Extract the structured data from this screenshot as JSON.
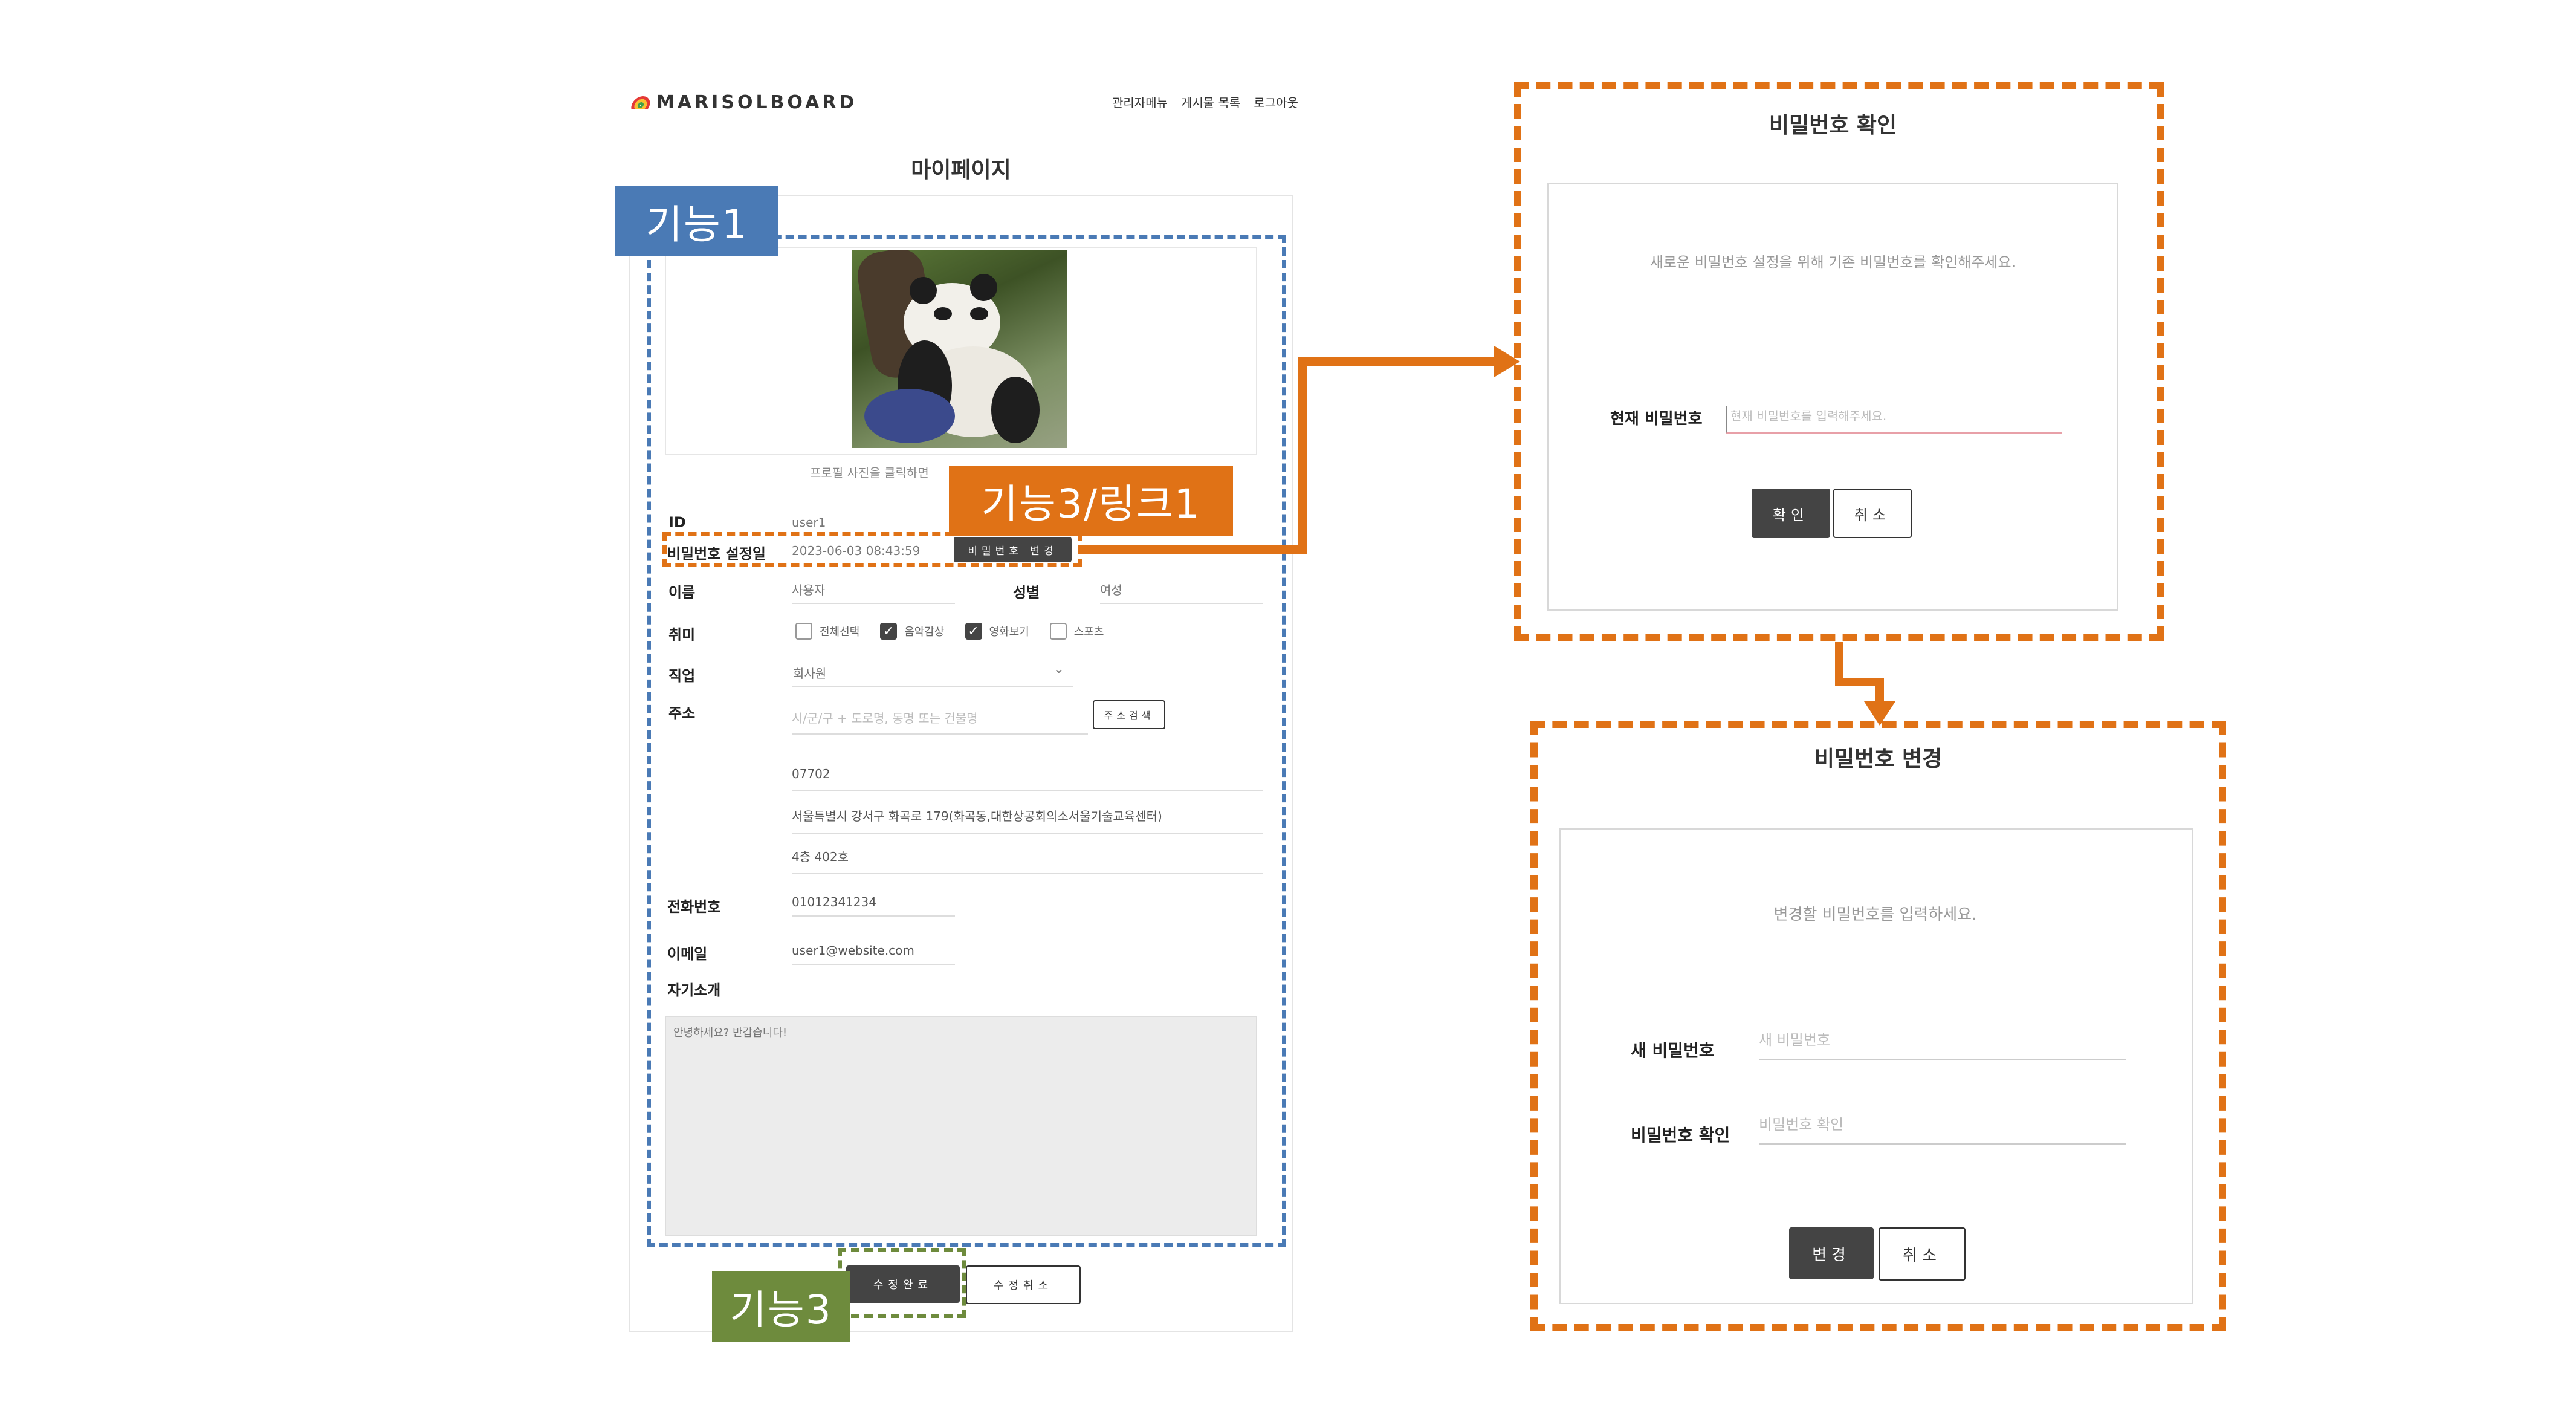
{
  "header": {
    "logo_text": "MARISOLBOARD",
    "nav": [
      "관리자메뉴",
      "게시물 목록",
      "로그아웃"
    ]
  },
  "page_title": "마이페이지",
  "profile": {
    "hint": "프로필 사진을 클릭하면"
  },
  "form": {
    "id_label": "ID",
    "id_value": "user1",
    "pw_date_label": "비밀번호 설정일",
    "pw_date_value": "2023-06-03 08:43:59",
    "pw_change_button": "비밀번호 변경",
    "name_label": "이름",
    "name_value": "사용자",
    "gender_label": "성별",
    "gender_value": "여성",
    "hobby_label": "취미",
    "hobbies": [
      {
        "label": "전체선택",
        "checked": false
      },
      {
        "label": "음악감상",
        "checked": true
      },
      {
        "label": "영화보기",
        "checked": true
      },
      {
        "label": "스포츠",
        "checked": false
      }
    ],
    "job_label": "직업",
    "job_value": "회사원",
    "address_label": "주소",
    "address_placeholder": "시/군/구 + 도로명, 동명 또는 건물명",
    "address_search_button": "주소검색",
    "zipcode": "07702",
    "address1": "서울특별시 강서구 화곡로 179(화곡동,대한상공회의소서울기술교육센터)",
    "address2": "4층 402호",
    "phone_label": "전화번호",
    "phone_value": "01012341234",
    "email_label": "이메일",
    "email_value": "user1@website.com",
    "intro_label": "자기소개",
    "intro_value": "안녕하세요? 반갑습니다!",
    "submit_button": "수정완료",
    "cancel_button": "수정취소"
  },
  "annotations": {
    "tag1": "기능1",
    "tag3_link": "기능3/링크1",
    "tag3": "기능3",
    "colors": {
      "blue": "#4a7ab5",
      "orange": "#e07216",
      "green": "#6e8b3d"
    }
  },
  "dialog_confirm": {
    "title": "비밀번호 확인",
    "message": "새로운 비밀번호 설정을 위해 기존 비밀번호를 확인해주세요.",
    "field_label": "현재 비밀번호",
    "field_placeholder": "현재 비밀번호를 입력해주세요.",
    "ok_button": "확인",
    "cancel_button": "취소"
  },
  "dialog_change": {
    "title": "비밀번호 변경",
    "message": "변경할 비밀번호를 입력하세요.",
    "new_pw_label": "새 비밀번호",
    "new_pw_placeholder": "새 비밀번호",
    "confirm_pw_label": "비밀번호 확인",
    "confirm_pw_placeholder": "비밀번호 확인",
    "change_button": "변경",
    "cancel_button": "취소"
  }
}
